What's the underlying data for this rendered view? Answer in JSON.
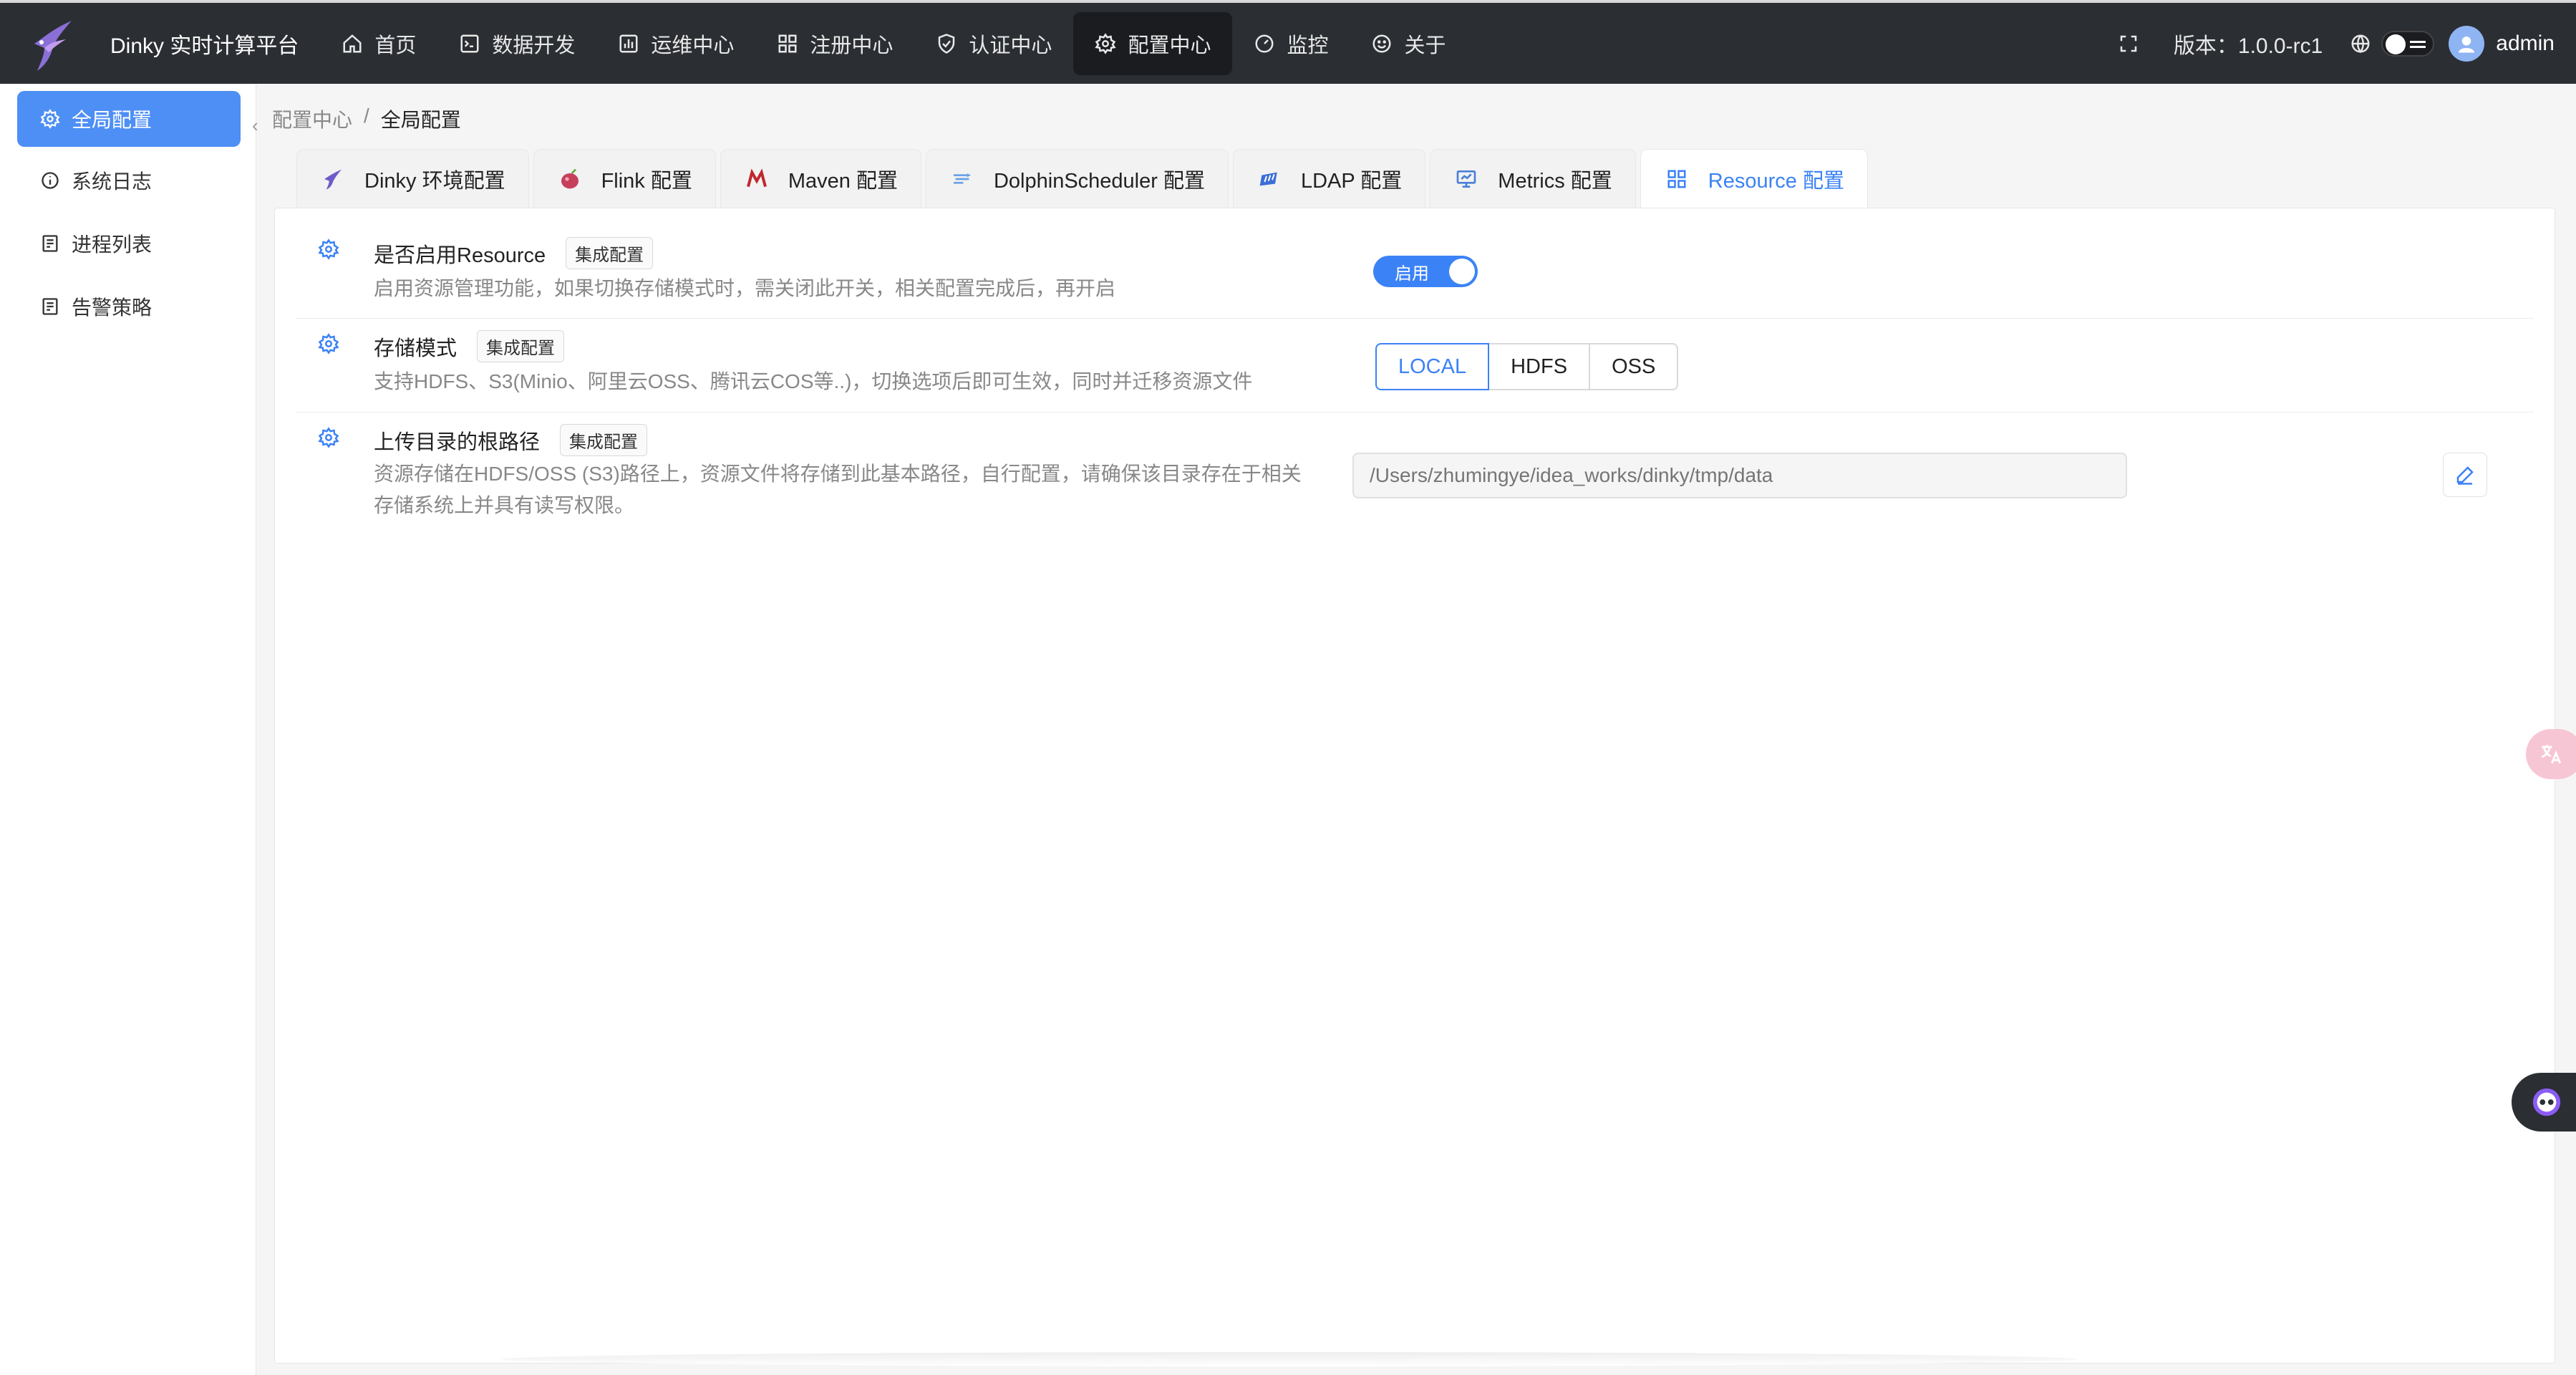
{
  "app": {
    "title": "Dinky 实时计算平台"
  },
  "nav": {
    "items": [
      {
        "label": "首页",
        "icon": "home-icon"
      },
      {
        "label": "数据开发",
        "icon": "terminal-icon"
      },
      {
        "label": "运维中心",
        "icon": "chart-box-icon"
      },
      {
        "label": "注册中心",
        "icon": "grid-icon"
      },
      {
        "label": "认证中心",
        "icon": "shield-check-icon"
      },
      {
        "label": "配置中心",
        "icon": "gear-icon",
        "active": true
      },
      {
        "label": "监控",
        "icon": "dashboard-icon"
      },
      {
        "label": "关于",
        "icon": "smile-icon"
      }
    ]
  },
  "header_right": {
    "version": "版本：1.0.0-rc1",
    "username": "admin"
  },
  "sidebar": {
    "items": [
      {
        "label": "全局配置",
        "icon": "gear-icon",
        "active": true
      },
      {
        "label": "系统日志",
        "icon": "info-icon"
      },
      {
        "label": "进程列表",
        "icon": "process-icon"
      },
      {
        "label": "告警策略",
        "icon": "alert-icon"
      }
    ]
  },
  "breadcrumb": {
    "parent": "配置中心",
    "separator": "/",
    "current": "全局配置"
  },
  "tabs": [
    {
      "label": "Dinky 环境配置",
      "icon": "dinky-icon"
    },
    {
      "label": "Flink 配置",
      "icon": "flink-icon"
    },
    {
      "label": "Maven 配置",
      "icon": "maven-icon"
    },
    {
      "label": "DolphinScheduler 配置",
      "icon": "dolphinscheduler-icon"
    },
    {
      "label": "LDAP 配置",
      "icon": "ldap-icon"
    },
    {
      "label": "Metrics 配置",
      "icon": "metrics-icon"
    },
    {
      "label": "Resource 配置",
      "icon": "resource-icon",
      "active": true
    }
  ],
  "settings": {
    "enable": {
      "title": "是否启用Resource",
      "tag": "集成配置",
      "desc": "启用资源管理功能，如果切换存储模式时，需关闭此开关，相关配置完成后，再开启",
      "switch_label": "启用",
      "on": true
    },
    "storage": {
      "title": "存储模式",
      "tag": "集成配置",
      "desc": "支持HDFS、S3(Minio、阿里云OSS、腾讯云COS等..)，切换选项后即可生效，同时并迁移资源文件",
      "options": [
        "LOCAL",
        "HDFS",
        "OSS"
      ],
      "selected": "LOCAL"
    },
    "upload": {
      "title": "上传目录的根路径",
      "tag": "集成配置",
      "desc_line1": "资源存储在HDFS/OSS (S3)路径上，资源文件将存储到此基本路径，自行配置，请确保该目录存在于相关",
      "desc_line2": "存储系统上并具有读写权限。",
      "placeholder": "/Users/zhumingye/idea_works/dinky/tmp/data"
    }
  },
  "colors": {
    "accent": "#3b82f6",
    "topbar": "#2b2e33",
    "sidebar_active": "#4d8ff5"
  }
}
